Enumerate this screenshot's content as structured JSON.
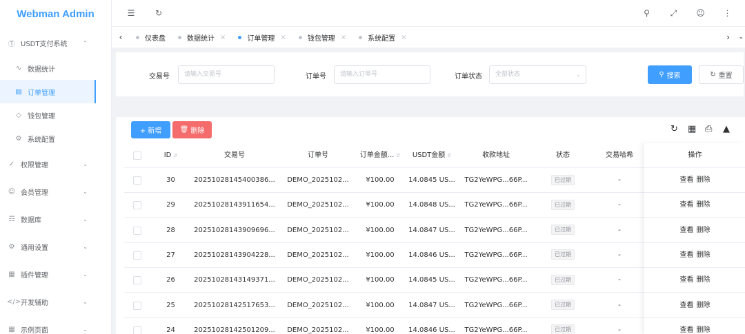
{
  "app": {
    "title": "Webman Admin"
  },
  "sidebar": {
    "groups": [
      {
        "label": "USDT支付系统",
        "icon": "dollar-circle-icon",
        "expanded": true,
        "items": [
          {
            "label": "数据统计",
            "icon": "chart-line-icon"
          },
          {
            "label": "订单管理",
            "icon": "document-icon",
            "active": true
          },
          {
            "label": "钱包管理",
            "icon": "diamond-icon"
          },
          {
            "label": "系统配置",
            "icon": "gear-icon"
          }
        ]
      },
      {
        "label": "权限管理",
        "icon": "check-circle-icon"
      },
      {
        "label": "会员管理",
        "icon": "user-icon"
      },
      {
        "label": "数据库",
        "icon": "database-icon"
      },
      {
        "label": "通用设置",
        "icon": "settings-icon"
      },
      {
        "label": "插件管理",
        "icon": "plugin-icon"
      },
      {
        "label": "开发辅助",
        "icon": "code-icon"
      },
      {
        "label": "示例页面",
        "icon": "grid-icon"
      }
    ]
  },
  "tabs": [
    {
      "label": "仪表盘",
      "closable": false
    },
    {
      "label": "数据统计",
      "closable": true
    },
    {
      "label": "订单管理",
      "closable": true,
      "active": true
    },
    {
      "label": "钱包管理",
      "closable": true
    },
    {
      "label": "系统配置",
      "closable": true
    }
  ],
  "search": {
    "tx_label": "交易号",
    "tx_placeholder": "请输入交易号",
    "order_label": "订单号",
    "order_placeholder": "请输入订单号",
    "status_label": "订单状态",
    "status_value": "全部状态",
    "search_button": "搜索",
    "reset_button": "重置"
  },
  "toolbar": {
    "add_label": "+ 新增",
    "delete_label": "删除"
  },
  "table": {
    "columns": [
      "ID",
      "交易号",
      "订单号",
      "订单金额...",
      "USDT金额",
      "收款地址",
      "状态",
      "交易哈希",
      "操作"
    ],
    "rows": [
      {
        "id": "30",
        "tx": "20251028145400386...",
        "order": "DEMO_2025102...",
        "amount": "¥100.00",
        "usdt": "14.0845 US...",
        "addr": "TG2YeWPG...66P...",
        "status": "已过期",
        "hash": "-"
      },
      {
        "id": "29",
        "tx": "20251028143911654...",
        "order": "DEMO_2025102...",
        "amount": "¥100.00",
        "usdt": "14.0848 US...",
        "addr": "TG2YeWPG...66P...",
        "status": "已过期",
        "hash": "-"
      },
      {
        "id": "28",
        "tx": "20251028143909696...",
        "order": "DEMO_2025102...",
        "amount": "¥100.00",
        "usdt": "14.0847 US...",
        "addr": "TG2YeWPG...66P...",
        "status": "已过期",
        "hash": "-"
      },
      {
        "id": "27",
        "tx": "20251028143904228...",
        "order": "DEMO_2025102...",
        "amount": "¥100.00",
        "usdt": "14.0846 US...",
        "addr": "TG2YeWPG...66P...",
        "status": "已过期",
        "hash": "-"
      },
      {
        "id": "26",
        "tx": "20251028143149371...",
        "order": "DEMO_2025102...",
        "amount": "¥100.00",
        "usdt": "14.0845 US...",
        "addr": "TG2YeWPG...66P...",
        "status": "已过期",
        "hash": "-"
      },
      {
        "id": "25",
        "tx": "20251028142517653...",
        "order": "DEMO_2025102...",
        "amount": "¥100.00",
        "usdt": "14.0847 US...",
        "addr": "TG2YeWPG...66P...",
        "status": "已过期",
        "hash": "-"
      },
      {
        "id": "24",
        "tx": "20251028142501209...",
        "order": "DEMO_2025102...",
        "amount": "¥100.00",
        "usdt": "14.0846 US...",
        "addr": "TG2YeWPG...66P...",
        "status": "已过期",
        "hash": "-"
      }
    ],
    "actions": {
      "view": "查看",
      "delete": "删除"
    }
  },
  "colors": {
    "primary": "#409eff",
    "danger": "#f56c6c",
    "active_bg": "#ecf5ff"
  }
}
